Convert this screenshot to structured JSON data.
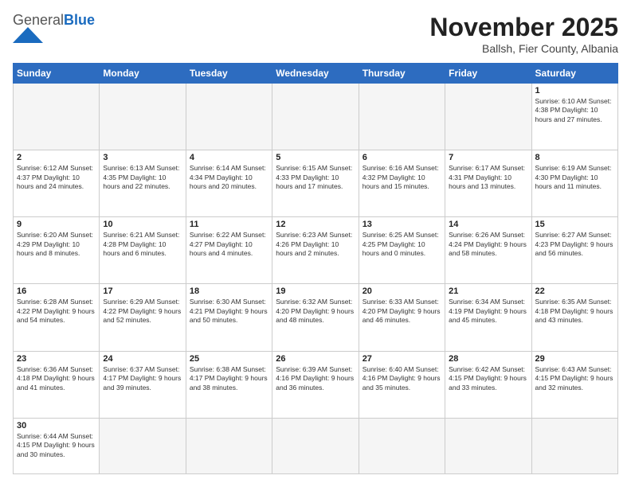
{
  "header": {
    "logo_general": "General",
    "logo_blue": "Blue",
    "month_title": "November 2025",
    "subtitle": "Ballsh, Fier County, Albania"
  },
  "days_of_week": [
    "Sunday",
    "Monday",
    "Tuesday",
    "Wednesday",
    "Thursday",
    "Friday",
    "Saturday"
  ],
  "weeks": [
    [
      {
        "day": "",
        "info": ""
      },
      {
        "day": "",
        "info": ""
      },
      {
        "day": "",
        "info": ""
      },
      {
        "day": "",
        "info": ""
      },
      {
        "day": "",
        "info": ""
      },
      {
        "day": "",
        "info": ""
      },
      {
        "day": "1",
        "info": "Sunrise: 6:10 AM\nSunset: 4:38 PM\nDaylight: 10 hours and 27 minutes."
      }
    ],
    [
      {
        "day": "2",
        "info": "Sunrise: 6:12 AM\nSunset: 4:37 PM\nDaylight: 10 hours and 24 minutes."
      },
      {
        "day": "3",
        "info": "Sunrise: 6:13 AM\nSunset: 4:35 PM\nDaylight: 10 hours and 22 minutes."
      },
      {
        "day": "4",
        "info": "Sunrise: 6:14 AM\nSunset: 4:34 PM\nDaylight: 10 hours and 20 minutes."
      },
      {
        "day": "5",
        "info": "Sunrise: 6:15 AM\nSunset: 4:33 PM\nDaylight: 10 hours and 17 minutes."
      },
      {
        "day": "6",
        "info": "Sunrise: 6:16 AM\nSunset: 4:32 PM\nDaylight: 10 hours and 15 minutes."
      },
      {
        "day": "7",
        "info": "Sunrise: 6:17 AM\nSunset: 4:31 PM\nDaylight: 10 hours and 13 minutes."
      },
      {
        "day": "8",
        "info": "Sunrise: 6:19 AM\nSunset: 4:30 PM\nDaylight: 10 hours and 11 minutes."
      }
    ],
    [
      {
        "day": "9",
        "info": "Sunrise: 6:20 AM\nSunset: 4:29 PM\nDaylight: 10 hours and 8 minutes."
      },
      {
        "day": "10",
        "info": "Sunrise: 6:21 AM\nSunset: 4:28 PM\nDaylight: 10 hours and 6 minutes."
      },
      {
        "day": "11",
        "info": "Sunrise: 6:22 AM\nSunset: 4:27 PM\nDaylight: 10 hours and 4 minutes."
      },
      {
        "day": "12",
        "info": "Sunrise: 6:23 AM\nSunset: 4:26 PM\nDaylight: 10 hours and 2 minutes."
      },
      {
        "day": "13",
        "info": "Sunrise: 6:25 AM\nSunset: 4:25 PM\nDaylight: 10 hours and 0 minutes."
      },
      {
        "day": "14",
        "info": "Sunrise: 6:26 AM\nSunset: 4:24 PM\nDaylight: 9 hours and 58 minutes."
      },
      {
        "day": "15",
        "info": "Sunrise: 6:27 AM\nSunset: 4:23 PM\nDaylight: 9 hours and 56 minutes."
      }
    ],
    [
      {
        "day": "16",
        "info": "Sunrise: 6:28 AM\nSunset: 4:22 PM\nDaylight: 9 hours and 54 minutes."
      },
      {
        "day": "17",
        "info": "Sunrise: 6:29 AM\nSunset: 4:22 PM\nDaylight: 9 hours and 52 minutes."
      },
      {
        "day": "18",
        "info": "Sunrise: 6:30 AM\nSunset: 4:21 PM\nDaylight: 9 hours and 50 minutes."
      },
      {
        "day": "19",
        "info": "Sunrise: 6:32 AM\nSunset: 4:20 PM\nDaylight: 9 hours and 48 minutes."
      },
      {
        "day": "20",
        "info": "Sunrise: 6:33 AM\nSunset: 4:20 PM\nDaylight: 9 hours and 46 minutes."
      },
      {
        "day": "21",
        "info": "Sunrise: 6:34 AM\nSunset: 4:19 PM\nDaylight: 9 hours and 45 minutes."
      },
      {
        "day": "22",
        "info": "Sunrise: 6:35 AM\nSunset: 4:18 PM\nDaylight: 9 hours and 43 minutes."
      }
    ],
    [
      {
        "day": "23",
        "info": "Sunrise: 6:36 AM\nSunset: 4:18 PM\nDaylight: 9 hours and 41 minutes."
      },
      {
        "day": "24",
        "info": "Sunrise: 6:37 AM\nSunset: 4:17 PM\nDaylight: 9 hours and 39 minutes."
      },
      {
        "day": "25",
        "info": "Sunrise: 6:38 AM\nSunset: 4:17 PM\nDaylight: 9 hours and 38 minutes."
      },
      {
        "day": "26",
        "info": "Sunrise: 6:39 AM\nSunset: 4:16 PM\nDaylight: 9 hours and 36 minutes."
      },
      {
        "day": "27",
        "info": "Sunrise: 6:40 AM\nSunset: 4:16 PM\nDaylight: 9 hours and 35 minutes."
      },
      {
        "day": "28",
        "info": "Sunrise: 6:42 AM\nSunset: 4:15 PM\nDaylight: 9 hours and 33 minutes."
      },
      {
        "day": "29",
        "info": "Sunrise: 6:43 AM\nSunset: 4:15 PM\nDaylight: 9 hours and 32 minutes."
      }
    ],
    [
      {
        "day": "30",
        "info": "Sunrise: 6:44 AM\nSunset: 4:15 PM\nDaylight: 9 hours and 30 minutes."
      },
      {
        "day": "",
        "info": ""
      },
      {
        "day": "",
        "info": ""
      },
      {
        "day": "",
        "info": ""
      },
      {
        "day": "",
        "info": ""
      },
      {
        "day": "",
        "info": ""
      },
      {
        "day": "",
        "info": ""
      }
    ]
  ]
}
